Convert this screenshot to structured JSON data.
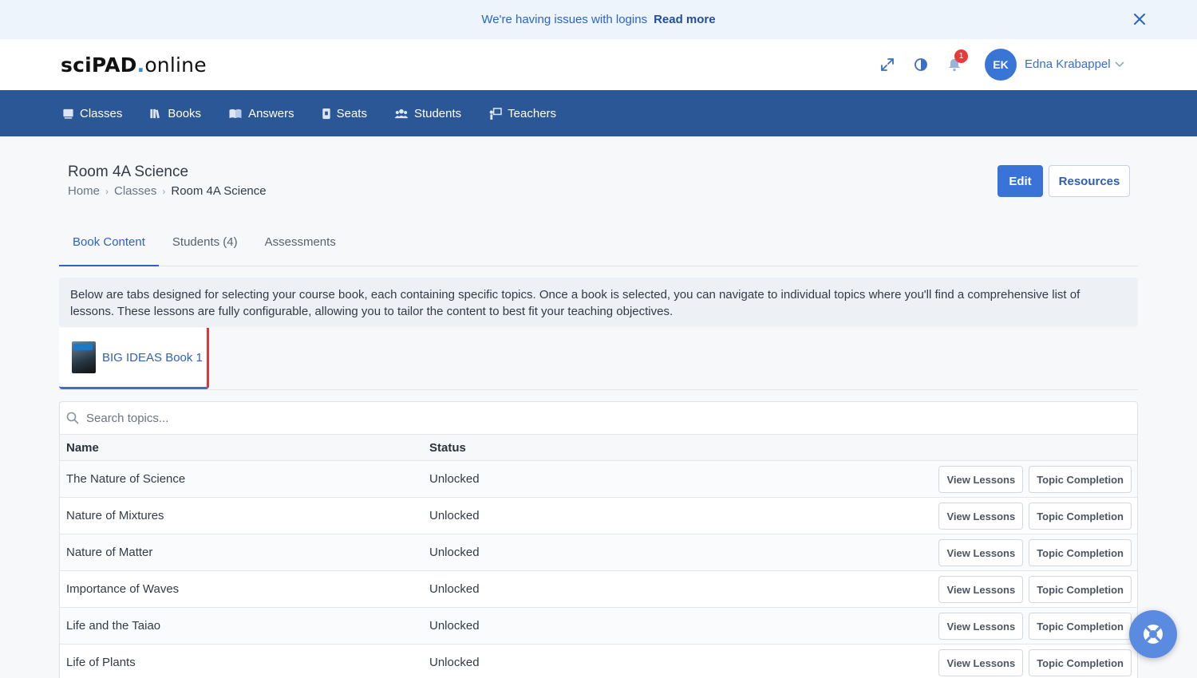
{
  "banner": {
    "message": "We're having issues with logins",
    "link": "Read more"
  },
  "header": {
    "logo_bold": "sciPAD",
    "logo_dot": ".",
    "logo_rest": "online",
    "notification_count": "1",
    "user_initials": "EK",
    "user_name": "Edna Krabappel"
  },
  "nav": {
    "items": [
      {
        "label": "Classes",
        "icon": "classes-icon"
      },
      {
        "label": "Books",
        "icon": "books-icon"
      },
      {
        "label": "Answers",
        "icon": "answers-icon"
      },
      {
        "label": "Seats",
        "icon": "seats-icon"
      },
      {
        "label": "Students",
        "icon": "students-icon"
      },
      {
        "label": "Teachers",
        "icon": "teachers-icon"
      }
    ]
  },
  "page": {
    "title": "Room 4A Science",
    "breadcrumb": [
      "Home",
      "Classes",
      "Room 4A Science"
    ],
    "edit_label": "Edit",
    "resources_label": "Resources"
  },
  "tabs": [
    "Book Content",
    "Students (4)",
    "Assessments"
  ],
  "info_text": "Below are tabs designed for selecting your course book, each containing specific topics. Once a book is selected, you can navigate to individual topics where you'll find a comprehensive list of lessons. These lessons are fully configurable, allowing you to tailor the content to best fit your teaching objectives.",
  "book": {
    "label": "BIG IDEAS Book 1",
    "cover_text": "scipad"
  },
  "table": {
    "search_placeholder": "Search topics...",
    "headers": {
      "name": "Name",
      "status": "Status"
    },
    "view_label": "View Lessons",
    "completion_label": "Topic Completion",
    "rows": [
      {
        "name": "The Nature of Science",
        "status": "Unlocked"
      },
      {
        "name": "Nature of Mixtures",
        "status": "Unlocked"
      },
      {
        "name": "Nature of Matter",
        "status": "Unlocked"
      },
      {
        "name": "Importance of Waves",
        "status": "Unlocked"
      },
      {
        "name": "Life and the Taiao",
        "status": "Unlocked"
      },
      {
        "name": "Life of Plants",
        "status": "Unlocked"
      }
    ]
  },
  "colors": {
    "navbar": "#2b5797",
    "accent": "#3a73d8",
    "banner_bg": "#eef4fb",
    "badge": "#e53b3b",
    "book_tab_right_border": "#e3343a"
  }
}
